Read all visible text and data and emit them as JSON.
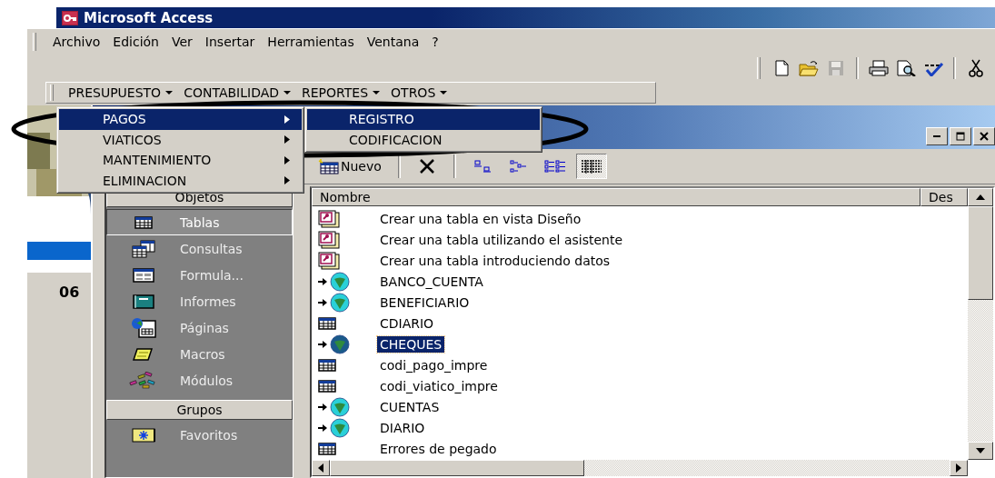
{
  "window": {
    "title": "Microsoft Access"
  },
  "menu_bar": [
    {
      "label": "Archivo"
    },
    {
      "label": "Edición"
    },
    {
      "label": "Ver"
    },
    {
      "label": "Insertar"
    },
    {
      "label": "Herramientas"
    },
    {
      "label": "Ventana"
    },
    {
      "label": "?"
    }
  ],
  "toolbar_groups": [
    {
      "buttons": [
        {
          "kind": "new",
          "disabled": false
        },
        {
          "kind": "open",
          "disabled": false
        },
        {
          "kind": "save",
          "disabled": true
        }
      ]
    },
    {
      "buttons": [
        {
          "kind": "print",
          "disabled": false
        },
        {
          "kind": "preview",
          "disabled": false
        },
        {
          "kind": "spelling",
          "disabled": false
        }
      ]
    },
    {
      "buttons": [
        {
          "kind": "cut",
          "disabled": false
        }
      ]
    }
  ],
  "command_bar": [
    {
      "label": "PRESUPUESTO"
    },
    {
      "label": "CONTABILIDAD"
    },
    {
      "label": "REPORTES"
    },
    {
      "label": "OTROS"
    }
  ],
  "dropdown_menu": [
    {
      "label": "PAGOS",
      "selected": true
    },
    {
      "label": "VIATICOS",
      "selected": false
    },
    {
      "label": "MANTENIMIENTO",
      "selected": false
    },
    {
      "label": "ELIMINACION",
      "selected": false
    }
  ],
  "submenu": [
    {
      "label": "REGISTRO",
      "selected": true
    },
    {
      "label": "CODIFICACION",
      "selected": false
    }
  ],
  "background_form": {
    "text": "06"
  },
  "database_window": {
    "toolbar": {
      "new_label": "Nuevo",
      "views": [
        {
          "kind": "large_icons",
          "selected": false
        },
        {
          "kind": "small_icons",
          "selected": false
        },
        {
          "kind": "list",
          "selected": false
        },
        {
          "kind": "details",
          "selected": true
        }
      ]
    },
    "objects_header": "Objetos",
    "object_types": [
      {
        "label": "Tablas",
        "kind": "table",
        "selected": true
      },
      {
        "label": "Consultas",
        "kind": "query",
        "selected": false
      },
      {
        "label": "Formula...",
        "kind": "form",
        "selected": false
      },
      {
        "label": "Informes",
        "kind": "report",
        "selected": false
      },
      {
        "label": "Páginas",
        "kind": "page",
        "selected": false
      },
      {
        "label": "Macros",
        "kind": "macro",
        "selected": false
      },
      {
        "label": "Módulos",
        "kind": "module",
        "selected": false
      }
    ],
    "groups_header": "Grupos",
    "groups": [
      {
        "label": "Favoritos",
        "kind": "favorites",
        "selected": false
      }
    ],
    "columns": [
      "Nombre",
      "Des"
    ],
    "items": [
      {
        "name": "Crear una tabla en vista Diseño",
        "kind": "shortcut",
        "selected": false
      },
      {
        "name": "Crear una tabla utilizando el asistente",
        "kind": "shortcut",
        "selected": false
      },
      {
        "name": "Crear una tabla introduciendo datos",
        "kind": "shortcut",
        "selected": false
      },
      {
        "name": "BANCO_CUENTA",
        "kind": "linked",
        "selected": false
      },
      {
        "name": "BENEFICIARIO",
        "kind": "linked",
        "selected": false
      },
      {
        "name": "CDIARIO",
        "kind": "table",
        "selected": false
      },
      {
        "name": "CHEQUES",
        "kind": "linked",
        "selected": true
      },
      {
        "name": "codi_pago_impre",
        "kind": "table",
        "selected": false
      },
      {
        "name": "codi_viatico_impre",
        "kind": "table",
        "selected": false
      },
      {
        "name": "CUENTAS",
        "kind": "linked",
        "selected": false
      },
      {
        "name": "DIARIO",
        "kind": "linked",
        "selected": false
      },
      {
        "name": "Errores de pegado",
        "kind": "table",
        "selected": false
      }
    ]
  }
}
